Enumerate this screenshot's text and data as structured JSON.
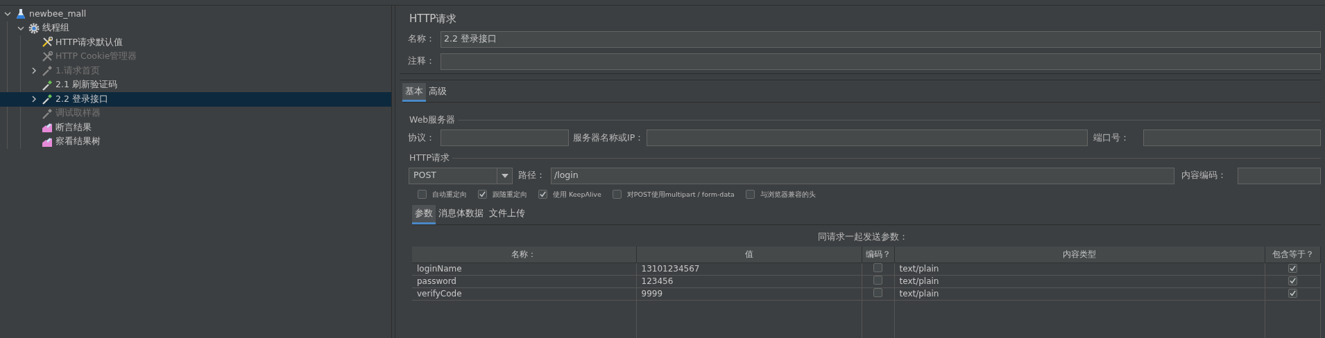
{
  "tree": [
    {
      "label": "newbee_mall",
      "kind": "plan",
      "expanded": true,
      "disabled": false,
      "selected": false,
      "children": [
        {
          "label": "线程组",
          "kind": "group",
          "expanded": true,
          "disabled": false,
          "selected": false,
          "children": [
            {
              "label": "HTTP请求默认值",
              "kind": "config",
              "disabled": false,
              "selected": false
            },
            {
              "label": "HTTP Cookie管理器",
              "kind": "config",
              "disabled": true,
              "selected": false
            },
            {
              "label": "1.请求首页",
              "kind": "sampler",
              "expanded": false,
              "disabled": true,
              "selected": false
            },
            {
              "label": "2.1 刷新验证码",
              "kind": "sampler",
              "disabled": false,
              "selected": false
            },
            {
              "label": "2.2 登录接口",
              "kind": "sampler",
              "expanded": false,
              "disabled": false,
              "selected": true
            },
            {
              "label": "调试取样器",
              "kind": "sampler",
              "disabled": true,
              "selected": false
            },
            {
              "label": "断言结果",
              "kind": "listener",
              "disabled": false,
              "selected": false
            },
            {
              "label": "察看结果树",
              "kind": "listener",
              "disabled": false,
              "selected": false
            }
          ]
        }
      ]
    }
  ],
  "panel": {
    "title": "HTTP请求",
    "name_label": "名称：",
    "name_value": "2.2 登录接口",
    "comment_label": "注释："
  },
  "tabs": [
    {
      "label": "基本",
      "selected": true
    },
    {
      "label": "高级",
      "selected": false
    }
  ],
  "web_server": {
    "legend": "Web服务器",
    "protocol_label": "协议：",
    "server_label": "服务器名称或IP：",
    "port_label": "端口号："
  },
  "http_request": {
    "legend": "HTTP请求",
    "method": "POST",
    "path_label": "路径：",
    "path": "/login",
    "encoding_label": "内容编码："
  },
  "options": [
    {
      "label": "自动重定向",
      "checked": false
    },
    {
      "label": "跟随重定向",
      "checked": true
    },
    {
      "label": "使用 KeepAlive",
      "checked": true
    },
    {
      "label": "对POST使用multipart / form-data",
      "checked": false
    },
    {
      "label": "与浏览器兼容的头",
      "checked": false
    }
  ],
  "sub_tabs": [
    {
      "label": "参数",
      "selected": true
    },
    {
      "label": "消息体数据",
      "selected": false
    },
    {
      "label": "文件上传",
      "selected": false
    }
  ],
  "params": {
    "caption": "同请求一起发送参数：",
    "columns": [
      "名称：",
      "值",
      "编码？",
      "内容类型",
      "包含等于？"
    ],
    "rows": [
      {
        "name": "loginName",
        "value": "13101234567",
        "encode": false,
        "content_type": "text/plain",
        "include_equals": true
      },
      {
        "name": "password",
        "value": "123456",
        "encode": false,
        "content_type": "text/plain",
        "include_equals": true
      },
      {
        "name": "verifyCode",
        "value": "9999",
        "encode": false,
        "content_type": "text/plain",
        "include_equals": true
      }
    ]
  }
}
